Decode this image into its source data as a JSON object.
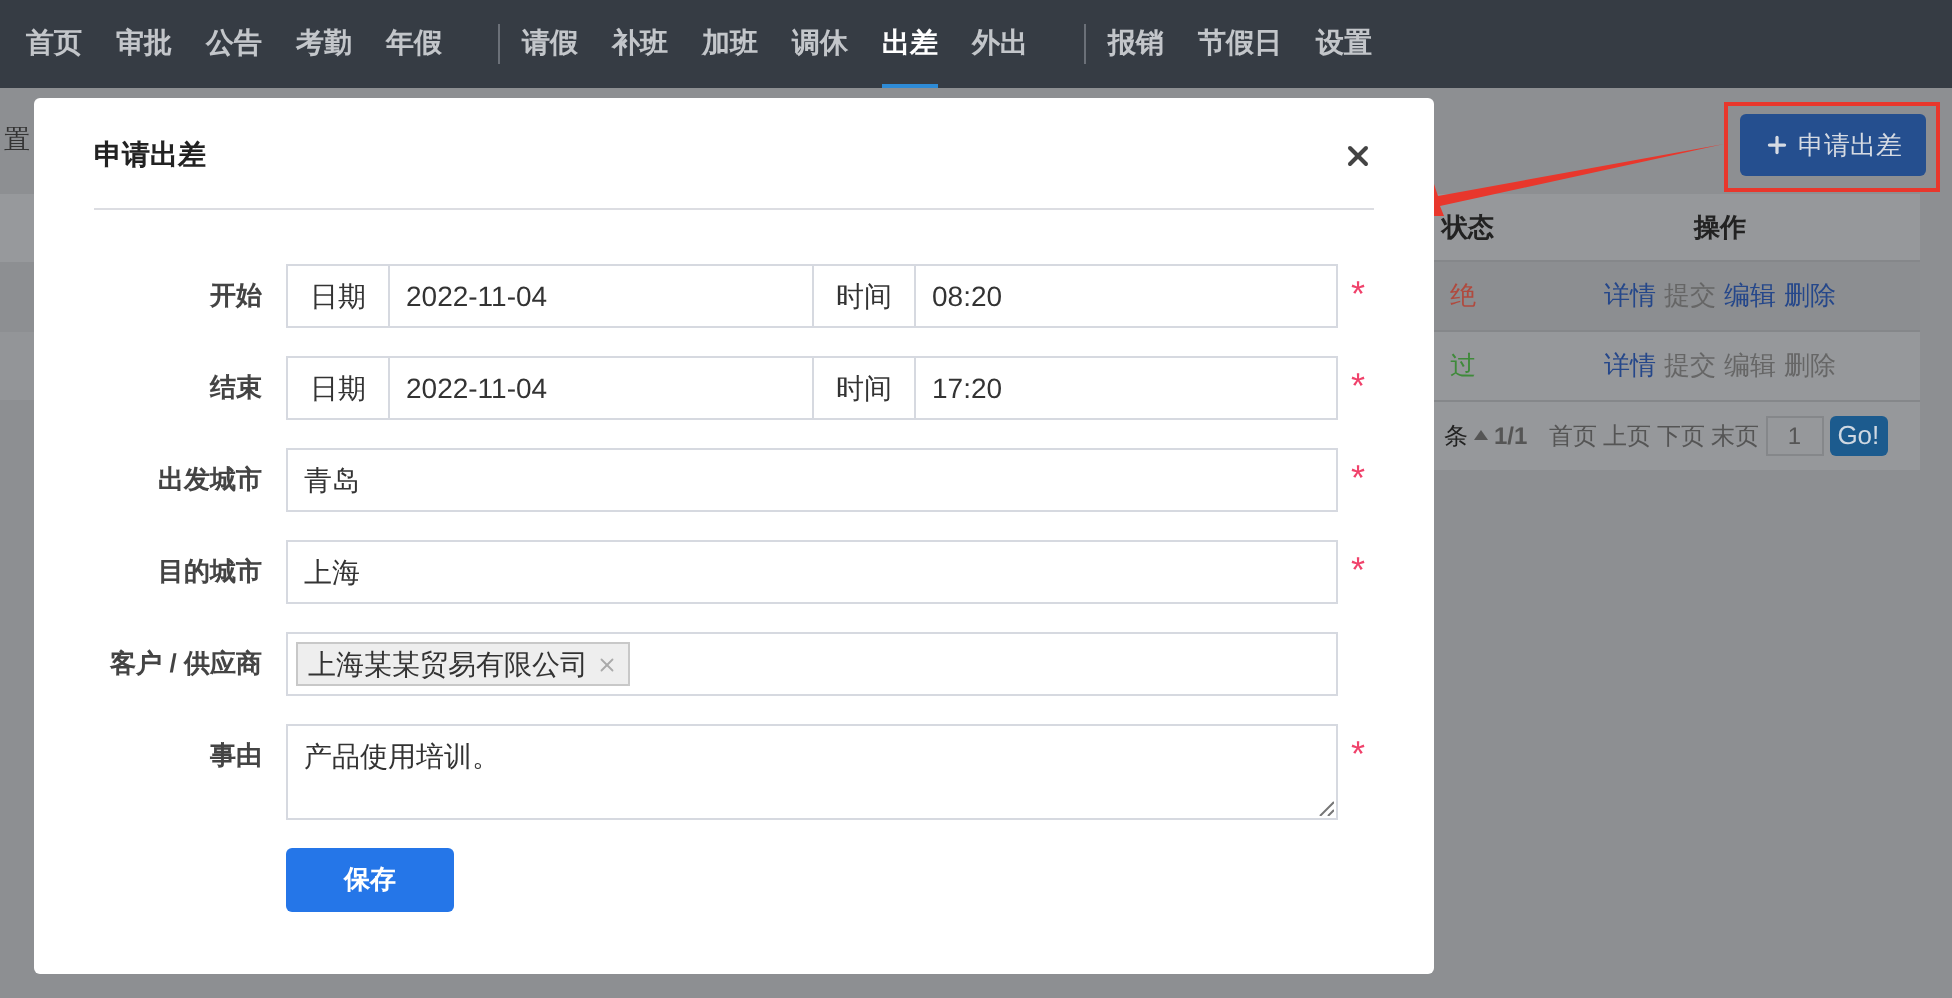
{
  "nav": {
    "groups": [
      [
        {
          "label": "首页",
          "selected": false
        },
        {
          "label": "审批",
          "selected": false
        },
        {
          "label": "公告",
          "selected": false
        },
        {
          "label": "考勤",
          "selected": false
        },
        {
          "label": "年假",
          "selected": false
        }
      ],
      [
        {
          "label": "请假",
          "selected": false
        },
        {
          "label": "补班",
          "selected": false
        },
        {
          "label": "加班",
          "selected": false
        },
        {
          "label": "调休",
          "selected": false
        },
        {
          "label": "出差",
          "selected": true
        },
        {
          "label": "外出",
          "selected": false
        }
      ],
      [
        {
          "label": "报销",
          "selected": false
        },
        {
          "label": "节假日",
          "selected": false
        },
        {
          "label": "设置",
          "selected": false
        }
      ]
    ]
  },
  "background": {
    "corner_text": "置",
    "new_button": "申请出差",
    "table": {
      "columns": [
        "状态",
        "操作"
      ],
      "rows": [
        {
          "status": "绝",
          "color": "#b04a3e",
          "actions": [
            {
              "label": "详情",
              "enabled": true
            },
            {
              "label": "提交",
              "enabled": false
            },
            {
              "label": "编辑",
              "enabled": true
            },
            {
              "label": "删除",
              "enabled": true
            }
          ]
        },
        {
          "status": "过",
          "color": "#3f8a3a",
          "actions": [
            {
              "label": "详情",
              "enabled": true
            },
            {
              "label": "提交",
              "enabled": false
            },
            {
              "label": "编辑",
              "enabled": false
            },
            {
              "label": "删除",
              "enabled": false
            }
          ]
        }
      ],
      "pagination": {
        "count": "条",
        "page": "1/1",
        "links": [
          "首页",
          "上页",
          "下页",
          "末页"
        ],
        "page_input": "1",
        "go": "Go!"
      }
    }
  },
  "dialog": {
    "title": "申请出差",
    "fields": [
      {
        "kind": "datetime",
        "label": "开始",
        "date_label": "日期",
        "date": "2022-11-04",
        "time_label": "时间",
        "time": "08:20",
        "required_mark": "*"
      },
      {
        "kind": "datetime",
        "label": "结束",
        "date_label": "日期",
        "date": "2022-11-04",
        "time_label": "时间",
        "time": "17:20",
        "required_mark": "*"
      },
      {
        "kind": "text",
        "label": "出发城市",
        "value": "青岛",
        "required_mark": "*"
      },
      {
        "kind": "text",
        "label": "目的城市",
        "value": "上海",
        "required_mark": "*"
      },
      {
        "kind": "tags",
        "label": "客户 / 供应商",
        "tags": [
          "上海某某贸易有限公司"
        ]
      },
      {
        "kind": "textarea",
        "label": "事由",
        "value": "产品使用培训。",
        "required_mark": "*"
      }
    ],
    "save": "保存"
  }
}
